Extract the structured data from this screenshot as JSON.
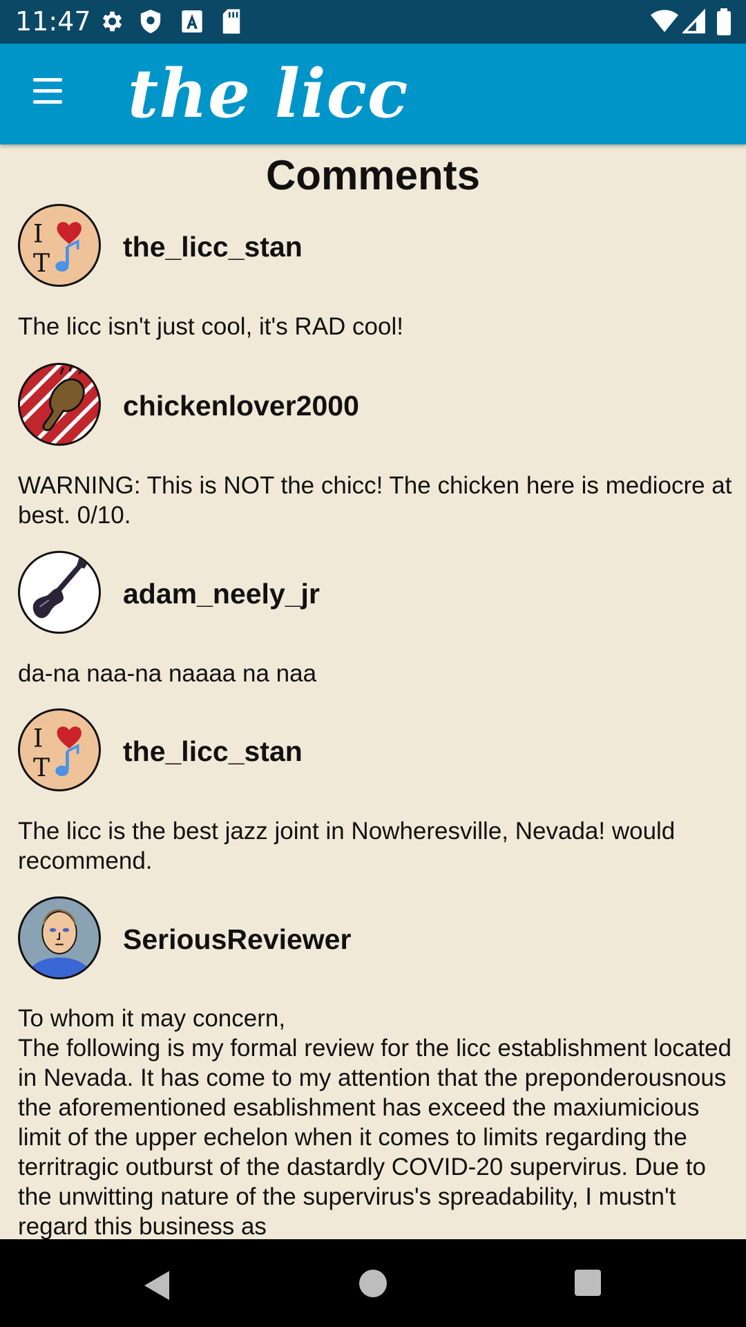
{
  "status_bar": {
    "time": "11:47"
  },
  "app_bar": {
    "title": "the licc",
    "menu_icon": "hamburger-menu-icon"
  },
  "page": {
    "title": "Comments"
  },
  "comments": [
    {
      "username": "the_licc_stan",
      "avatar": "i-heart-music-avatar",
      "text": "The licc isn't just cool, it's RAD cool!"
    },
    {
      "username": "chickenlover2000",
      "avatar": "chicken-leg-avatar",
      "text": "WARNING: This is NOT the chicc! The chicken here is mediocre at best. 0/10."
    },
    {
      "username": "adam_neely_jr",
      "avatar": "bass-guitar-avatar",
      "text": "da-na naa-na naaaa na naa"
    },
    {
      "username": "the_licc_stan",
      "avatar": "i-heart-music-avatar",
      "text": "The licc is the best jazz joint in Nowheresville, Nevada! would recommend."
    },
    {
      "username": "SeriousReviewer",
      "avatar": "man-portrait-avatar",
      "text": "To whom it may concern,\nThe following is my formal review for the licc establishment located in Nevada. It has come to my attention that the preponderousnous the aforementioned esablishment has exceed the maxiumicious limit of the upper echelon when it comes to limits regarding the territragic outburst of the dastardly COVID-20 supervirus. Due to the unwitting nature of the supervirus's spreadability, I mustn't regard this business as"
    }
  ],
  "colors": {
    "status_bar": "#0b4866",
    "app_bar": "#0095c8",
    "background": "#f1e9d8"
  }
}
